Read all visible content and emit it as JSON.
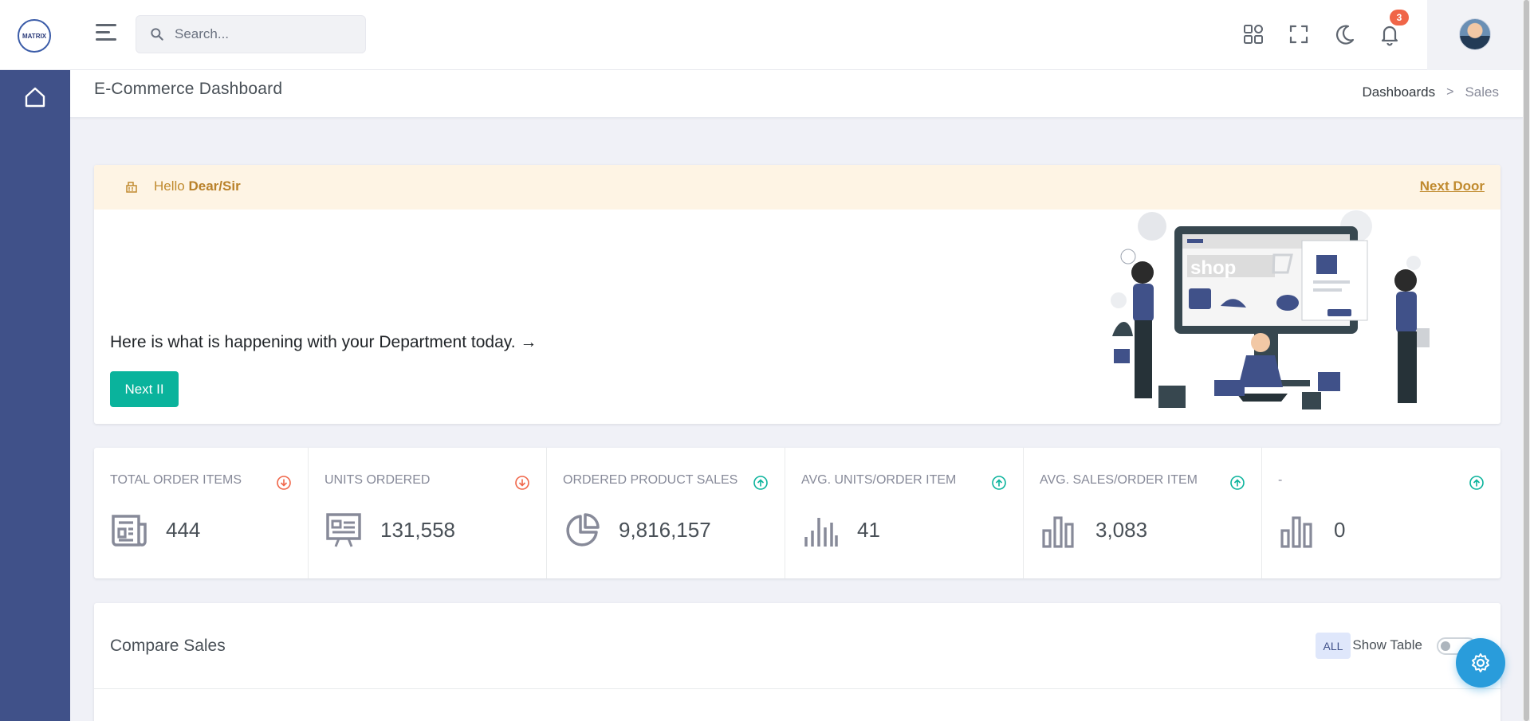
{
  "header": {
    "logo_text": "MATRIX",
    "search": {
      "placeholder": "Search..."
    },
    "notifications_count": "3",
    "icons": [
      "menu-icon",
      "search-icon",
      "apps-grid-icon",
      "fullscreen-icon",
      "moon-icon",
      "bell-icon"
    ]
  },
  "sidebar": {
    "items": [
      {
        "icon": "home-icon"
      }
    ]
  },
  "page": {
    "title": "E-Commerce Dashboard",
    "breadcrumb": {
      "parent": "Dashboards",
      "separator": ">",
      "current": "Sales"
    }
  },
  "welcome": {
    "alert_prefix": "Hello",
    "alert_name": "Dear/Sir",
    "alert_link": "Next Door",
    "message": "Here is what is happening with your Department today. →",
    "button": "Next II",
    "illustration_text": "shop"
  },
  "stats": [
    {
      "label": "TOTAL ORDER ITEMS",
      "value": "444",
      "trend": "down",
      "icon": "newspaper-icon"
    },
    {
      "label": "UNITS ORDERED",
      "value": "131,558",
      "trend": "down",
      "icon": "presentation-icon"
    },
    {
      "label": "ORDERED PRODUCT SALES",
      "value": "9,816,157",
      "trend": "up",
      "icon": "pie-chart-icon"
    },
    {
      "label": "AVG. UNITS/ORDER ITEM",
      "value": "41",
      "trend": "up",
      "icon": "bar-lines-icon"
    },
    {
      "label": "AVG. SALES/ORDER ITEM",
      "value": "3,083",
      "trend": "up",
      "icon": "bar-chart-icon"
    },
    {
      "label": "-",
      "value": "0",
      "trend": "up",
      "icon": "bar-chart-icon"
    }
  ],
  "compare": {
    "title": "Compare Sales",
    "all_button": "ALL",
    "show_table_label": "Show Table",
    "show_table_on": false
  },
  "colors": {
    "sidebar": "#405189",
    "success": "#0ab39c",
    "danger": "#f06548",
    "warning_text": "#c08a2e",
    "info": "#299cdb"
  }
}
